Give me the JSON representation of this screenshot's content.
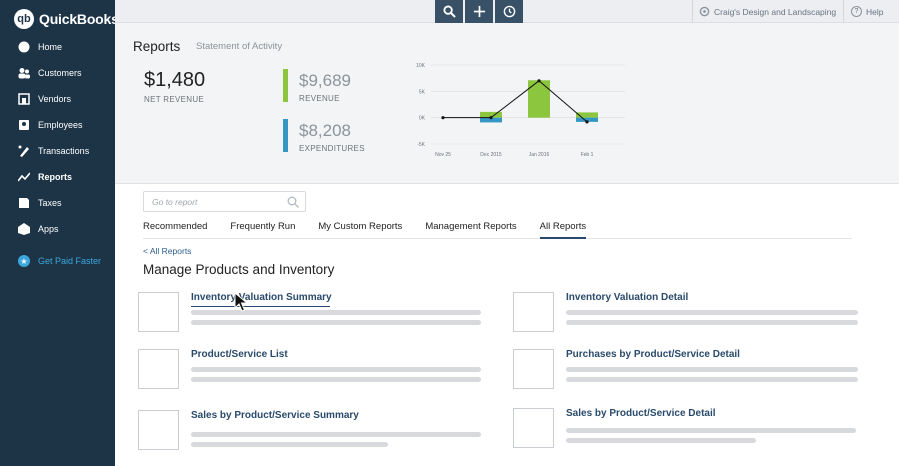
{
  "app": {
    "brand": "QuickBooks"
  },
  "sidebar": {
    "items": [
      {
        "label": "Home",
        "icon": "home-icon"
      },
      {
        "label": "Customers",
        "icon": "customers-icon"
      },
      {
        "label": "Vendors",
        "icon": "vendors-icon"
      },
      {
        "label": "Employees",
        "icon": "employees-icon"
      },
      {
        "label": "Transactions",
        "icon": "transactions-icon"
      },
      {
        "label": "Reports",
        "icon": "reports-icon",
        "active": true
      },
      {
        "label": "Taxes",
        "icon": "taxes-icon"
      },
      {
        "label": "Apps",
        "icon": "apps-icon"
      }
    ],
    "promo": "Get Paid Faster"
  },
  "topbar": {
    "buttons": [
      "search-icon",
      "plus-icon",
      "recent-icon"
    ],
    "company": "Craig's Design and Landscaping",
    "help": "Help"
  },
  "summary": {
    "title": "Reports",
    "subtitle": "Statement of Activity",
    "net_revenue": {
      "value": "$1,480",
      "label": "NET REVENUE"
    },
    "revenue": {
      "value": "$9,689",
      "label": "REVENUE",
      "color": "#8cc63f"
    },
    "expenditures": {
      "value": "$8,208",
      "label": "EXPENDITURES",
      "color": "#3597c4"
    }
  },
  "chart_data": {
    "type": "bar",
    "categories": [
      "Nov 25",
      "Dec 2015",
      "Jan 2016",
      "Feb 1"
    ],
    "y_ticks": [
      "10K",
      "5K",
      "0K",
      "-5K"
    ],
    "ylim": [
      -5000,
      10000
    ],
    "series": [
      {
        "name": "Revenue",
        "kind": "bar",
        "color": "#8cc63f",
        "values": [
          0,
          1100,
          7100,
          1000
        ]
      },
      {
        "name": "Expenditures",
        "kind": "bar",
        "color": "#3597c4",
        "values": [
          0,
          -900,
          0,
          -800
        ]
      },
      {
        "name": "Net",
        "kind": "line",
        "color": "#111111",
        "values": [
          0,
          0,
          7000,
          -800
        ]
      }
    ],
    "grid": true
  },
  "main": {
    "search_placeholder": "Go to report",
    "tabs": [
      "Recommended",
      "Frequently Run",
      "My Custom Reports",
      "Management Reports",
      "All Reports"
    ],
    "active_tab": "All Reports",
    "back_link": "< All Reports",
    "section_title": "Manage Products and Inventory",
    "reports_left": [
      "Inventory Valuation Summary",
      "Product/Service List",
      "Sales by Product/Service Summary"
    ],
    "reports_right": [
      "Inventory Valuation Detail",
      "Purchases by Product/Service Detail",
      "Sales by Product/Service Detail"
    ]
  }
}
